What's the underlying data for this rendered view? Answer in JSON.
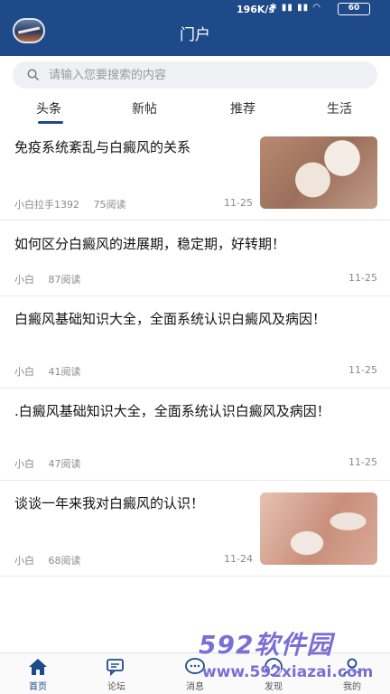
{
  "status": {
    "network_speed": "196K/s",
    "battery": "60"
  },
  "header": {
    "title": "门户"
  },
  "search": {
    "placeholder": "请输入您要搜索的内容"
  },
  "tabs": [
    {
      "label": "头条",
      "active": true
    },
    {
      "label": "新帖",
      "active": false
    },
    {
      "label": "推荐",
      "active": false
    },
    {
      "label": "生活",
      "active": false
    }
  ],
  "articles": [
    {
      "title": "免疫系统紊乱与白癜风的关系",
      "author": "小白拉手1392",
      "reads": "75阅读",
      "date": "11-25",
      "has_image": true
    },
    {
      "title": "如何区分白癜风的进展期，稳定期，好转期！",
      "author": "小白",
      "reads": "87阅读",
      "date": "11-25",
      "has_image": false
    },
    {
      "title": "白癜风基础知识大全，全面系统认识白癜风及病因！",
      "author": "小白",
      "reads": "41阅读",
      "date": "11-25",
      "has_image": false
    },
    {
      "title": ".白癜风基础知识大全，全面系统认识白癜风及病因！",
      "author": "小白",
      "reads": "47阅读",
      "date": "11-25",
      "has_image": false
    },
    {
      "title": "谈谈一年来我对白癜风的认识！",
      "author": "小白",
      "reads": "68阅读",
      "date": "11-24",
      "has_image": true
    }
  ],
  "bottom_nav": [
    {
      "label": "首页",
      "icon": "home-icon",
      "active": true
    },
    {
      "label": "论坛",
      "icon": "forum-icon",
      "active": false
    },
    {
      "label": "消息",
      "icon": "message-icon",
      "active": false
    },
    {
      "label": "发现",
      "icon": "discover-icon",
      "active": false
    },
    {
      "label": "我的",
      "icon": "profile-icon",
      "active": false
    }
  ],
  "watermark": {
    "logo_text": "592软件园",
    "url": "www.592xiazai.com"
  },
  "colors": {
    "primary": "#1f4a8a",
    "watermark": "#7a6fd6"
  }
}
